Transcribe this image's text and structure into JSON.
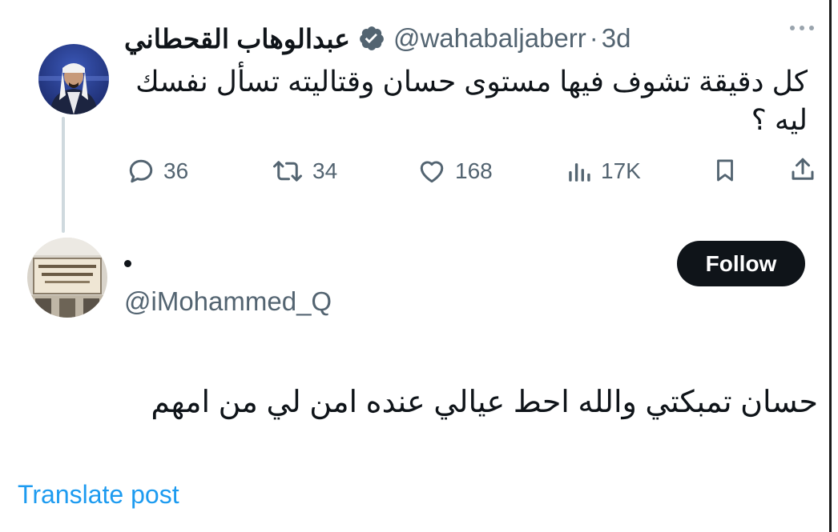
{
  "tweet": {
    "display_name": "عبدالوهاب القحطاني",
    "handle": "@wahabaljaberr",
    "separator": "·",
    "time": "3d",
    "text_line1": "كل دقيقة تشوف فيها مستوى حسان وقتاليته تسأل نفسك",
    "text_line2": "ليه ؟",
    "stats": {
      "replies": "36",
      "reposts": "34",
      "likes": "168",
      "views": "17K"
    }
  },
  "reply": {
    "display_name": "•",
    "handle": "@iMohammed_Q",
    "follow_label": "Follow",
    "text": "حسان تمبكتي والله احط عيالي عنده امن لي من امهم",
    "translate_label": "Translate post"
  },
  "icons": {
    "reply": "reply-icon",
    "repost": "repost-icon",
    "like": "heart-icon",
    "views": "views-icon",
    "bookmark": "bookmark-icon",
    "share": "share-icon",
    "verified": "verified-badge-icon",
    "more": "more-icon"
  },
  "colors": {
    "text": "#0f1419",
    "secondary": "#536471",
    "link": "#1d9bf0",
    "verified": "#536471",
    "button_bg": "#0f1419"
  }
}
